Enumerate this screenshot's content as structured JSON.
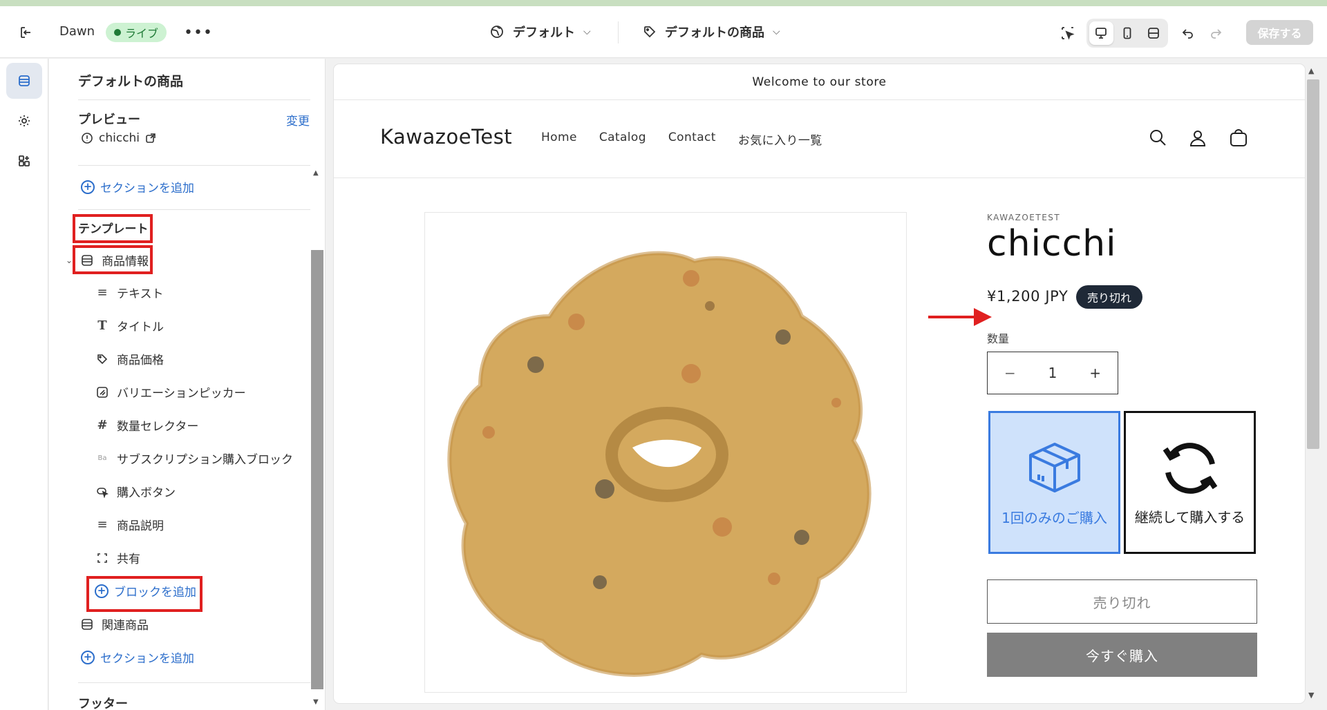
{
  "topbar": {
    "theme_name": "Dawn",
    "live_badge": "ライブ",
    "template_select": "デフォルト",
    "product_select": "デフォルトの商品",
    "save_button": "保存する"
  },
  "sidebar": {
    "title": "デフォルトの商品",
    "preview_label": "プレビュー",
    "change_link": "変更",
    "preview_product": "chicchi",
    "add_section_top": "セクションを追加",
    "template_label": "テンプレート",
    "section_product_info": "商品情報",
    "blocks": [
      {
        "label": "テキスト",
        "icon": "text-lines-icon"
      },
      {
        "label": "タイトル",
        "icon": "title-t-icon"
      },
      {
        "label": "商品価格",
        "icon": "price-tag-icon"
      },
      {
        "label": "バリエーションピッカー",
        "icon": "variant-picker-icon"
      },
      {
        "label": "数量セレクター",
        "icon": "hash-icon"
      },
      {
        "label": "サブスクリプション購入ブロック",
        "icon": "app-block-icon"
      },
      {
        "label": "購入ボタン",
        "icon": "buy-button-icon"
      },
      {
        "label": "商品説明",
        "icon": "text-lines-icon"
      },
      {
        "label": "共有",
        "icon": "share-icon"
      }
    ],
    "add_block": "ブロックを追加",
    "section_related": "関連商品",
    "add_section_bottom": "セクションを追加",
    "footer_label": "フッター"
  },
  "store": {
    "announcement": "Welcome to our store",
    "logo": "KawazoeTest",
    "nav": [
      "Home",
      "Catalog",
      "Contact",
      "お気に入り一覧"
    ],
    "vendor": "KAWAZOETEST",
    "product_title": "chicchi",
    "price": "¥1,200 JPY",
    "sold_out_badge": "売り切れ",
    "quantity_label": "数量",
    "quantity_minus": "−",
    "quantity_value": "1",
    "quantity_plus": "+",
    "option_one_time": "1回のみのご購入",
    "option_subscribe": "継続して購入する",
    "sold_out_button": "売り切れ",
    "buy_now_button": "今すぐ購入"
  },
  "colors": {
    "accent_blue": "#2c6ecb",
    "annotation_red": "#e02020",
    "live_green": "#1f7a36",
    "selected_option_bg": "#cfe2fb"
  }
}
